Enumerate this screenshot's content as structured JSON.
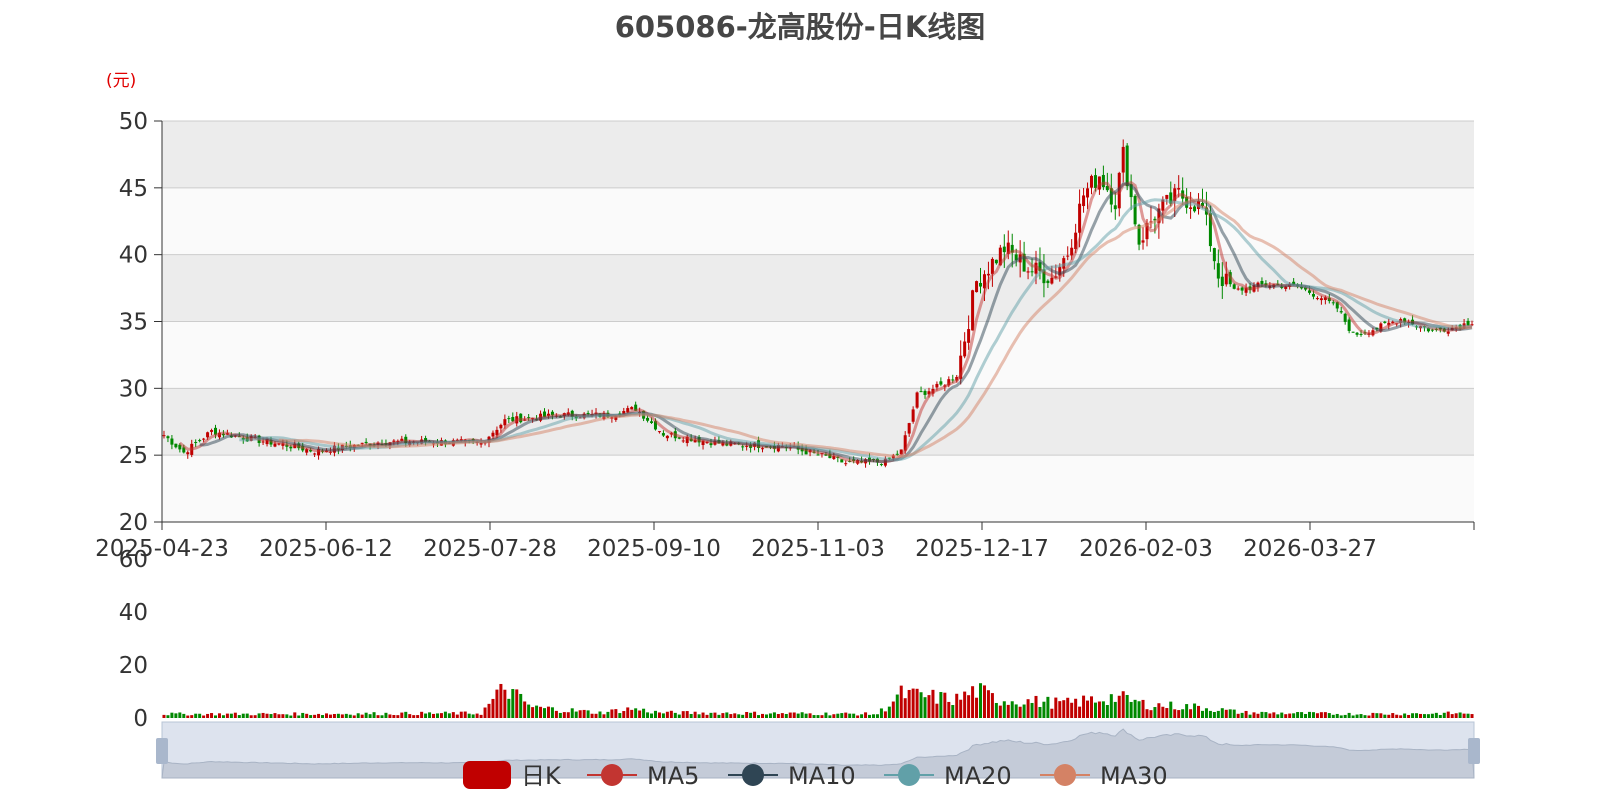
{
  "title": "605086-龙高股份-日K线图",
  "chart_data": {
    "type": "candlestick",
    "title": "605086-龙高股份-日K线图",
    "y_unit_label": "(元)",
    "price_axis": {
      "ylim": [
        20,
        50
      ],
      "ticks": [
        "20",
        "25",
        "30",
        "35",
        "40",
        "45",
        "50"
      ]
    },
    "volume_axis": {
      "ylim": [
        0,
        60
      ],
      "ticks": [
        "0",
        "20",
        "40",
        "60"
      ]
    },
    "x_tick_labels": [
      "2025-04-23",
      "2025-06-12",
      "2025-07-28",
      "2025-09-10",
      "2025-11-03",
      "2025-12-17",
      "2026-02-03",
      "2026-03-27"
    ],
    "colors": {
      "up": "#c00000",
      "down": "#008800",
      "ma5": "#c23531",
      "ma10": "#2f4554",
      "ma20": "#61a0a8",
      "ma30": "#d48265",
      "band_odd": "#ececec",
      "band_even": "#fafafa",
      "slider": "#dde3ee"
    },
    "close_anchors": [
      [
        0,
        26.5
      ],
      [
        5,
        25.2
      ],
      [
        12,
        26.8
      ],
      [
        22,
        26.2
      ],
      [
        30,
        25.8
      ],
      [
        38,
        25.3
      ],
      [
        55,
        26.0
      ],
      [
        72,
        26.0
      ],
      [
        80,
        25.9
      ],
      [
        86,
        27.6
      ],
      [
        100,
        28.0
      ],
      [
        112,
        28.0
      ],
      [
        119,
        28.5
      ],
      [
        126,
        26.6
      ],
      [
        142,
        25.8
      ],
      [
        156,
        25.7
      ],
      [
        168,
        24.8
      ],
      [
        172,
        24.4
      ],
      [
        182,
        24.5
      ],
      [
        186,
        25.3
      ],
      [
        190,
        29.5
      ],
      [
        196,
        30.2
      ],
      [
        200,
        31.0
      ],
      [
        203,
        35.2
      ],
      [
        205,
        38.0
      ],
      [
        212,
        40.5
      ],
      [
        218,
        39.0
      ],
      [
        224,
        38.3
      ],
      [
        228,
        40.2
      ],
      [
        232,
        44.5
      ],
      [
        236,
        46.0
      ],
      [
        240,
        44.0
      ],
      [
        242,
        47.5
      ],
      [
        246,
        41.0
      ],
      [
        250,
        43.0
      ],
      [
        256,
        44.5
      ],
      [
        262,
        43.5
      ],
      [
        266,
        38.5
      ],
      [
        270,
        37.3
      ],
      [
        278,
        37.8
      ],
      [
        286,
        37.6
      ],
      [
        292,
        36.8
      ],
      [
        296,
        36.0
      ],
      [
        300,
        34.0
      ],
      [
        306,
        34.5
      ],
      [
        312,
        35.2
      ],
      [
        320,
        34.3
      ],
      [
        326,
        34.6
      ],
      [
        330,
        35.0
      ]
    ],
    "ma_periods": [
      5,
      10,
      20,
      30
    ],
    "volume_levels": [
      [
        0,
        1.5
      ],
      [
        30,
        1.5
      ],
      [
        80,
        1.8
      ],
      [
        86,
        11.5
      ],
      [
        90,
        7.0
      ],
      [
        93,
        4.0
      ],
      [
        110,
        2.0
      ],
      [
        118,
        3.5
      ],
      [
        125,
        2.0
      ],
      [
        180,
        1.5
      ],
      [
        186,
        9.0
      ],
      [
        200,
        7.0
      ],
      [
        205,
        10.5
      ],
      [
        210,
        7.0
      ],
      [
        228,
        5.5
      ],
      [
        240,
        8.0
      ],
      [
        248,
        5.0
      ],
      [
        262,
        4.0
      ],
      [
        272,
        2.0
      ],
      [
        300,
        1.5
      ],
      [
        330,
        1.8
      ]
    ],
    "legend": [
      {
        "label": "日K",
        "color": "#c00000"
      },
      {
        "label": "MA5",
        "color": "#c23531"
      },
      {
        "label": "MA10",
        "color": "#2f4554"
      },
      {
        "label": "MA20",
        "color": "#61a0a8"
      },
      {
        "label": "MA30",
        "color": "#d48265"
      }
    ],
    "grid": true,
    "datazoom_slider": true
  }
}
